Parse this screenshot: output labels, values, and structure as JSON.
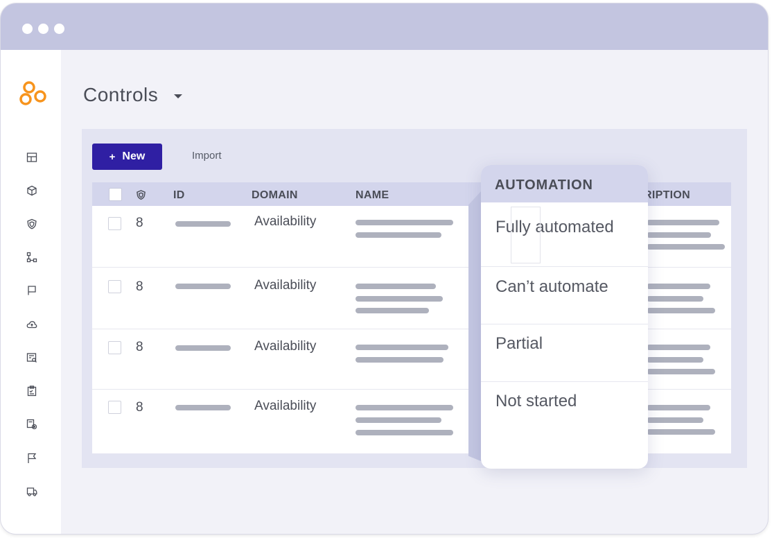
{
  "window": {
    "title_dots": [
      "close",
      "minimize",
      "maximize"
    ]
  },
  "sidebar": {
    "logo": "brand-logo",
    "items": [
      {
        "icon": "dashboard-icon"
      },
      {
        "icon": "cube-icon"
      },
      {
        "icon": "shield-icon"
      },
      {
        "icon": "workflow-icon"
      },
      {
        "icon": "bookmark-flag-icon"
      },
      {
        "icon": "cloud-upload-icon"
      },
      {
        "icon": "report-search-icon"
      },
      {
        "icon": "clipboard-check-icon"
      },
      {
        "icon": "settings-doc-icon"
      },
      {
        "icon": "flag-icon"
      },
      {
        "icon": "truck-icon"
      }
    ]
  },
  "page": {
    "title": "Controls"
  },
  "toolbar": {
    "new_label": "New",
    "new_plus": "+",
    "import_label": "Import"
  },
  "table": {
    "columns": {
      "id": "ID",
      "domain": "DOMAIN",
      "name": "NAME",
      "description": "RIPTION"
    },
    "rows": [
      {
        "id": "8",
        "domain": "Availability"
      },
      {
        "id": "8",
        "domain": "Availability"
      },
      {
        "id": "8",
        "domain": "Availability"
      },
      {
        "id": "8",
        "domain": "Availability"
      }
    ]
  },
  "automation_dropdown": {
    "header": "AUTOMATION",
    "options": [
      "Fully automated",
      "Can’t automate",
      "Partial",
      "Not started"
    ]
  },
  "colors": {
    "accent": "#2f1fa3",
    "brand": "#f7941d",
    "titlebar": "#c3c5e0",
    "header": "#d3d5ec"
  }
}
